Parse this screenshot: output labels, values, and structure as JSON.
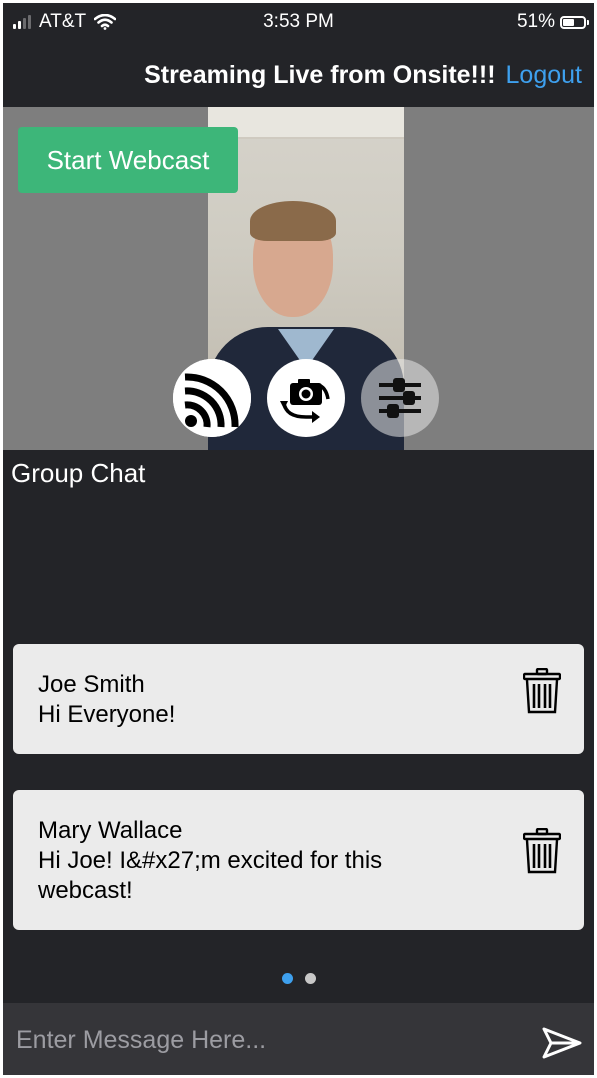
{
  "status_bar": {
    "carrier": "AT&T",
    "time": "3:53 PM",
    "battery": "51%",
    "battery_level": 0.51,
    "icons": [
      "signal-icon",
      "wifi-icon",
      "battery-icon"
    ]
  },
  "header": {
    "title": "Streaming Live from Onsite!!!",
    "logout_label": "Logout"
  },
  "video": {
    "start_button_label": "Start Webcast",
    "controls": [
      "broadcast-icon",
      "switch-camera-icon",
      "settings-sliders-icon"
    ]
  },
  "chat": {
    "title": "Group Chat",
    "messages": [
      {
        "name": "Joe Smith",
        "text": "Hi Everyone!"
      },
      {
        "name": "Mary Wallace",
        "text": "Hi Joe!  I&#x27;m excited for this webcast!"
      }
    ],
    "page_count": 2,
    "current_page": 1
  },
  "input": {
    "placeholder": "Enter Message Here...",
    "value": ""
  },
  "colors": {
    "background": "#232428",
    "accent": "#3ea0ee",
    "start_button": "#3db679",
    "card": "#ebebeb"
  }
}
